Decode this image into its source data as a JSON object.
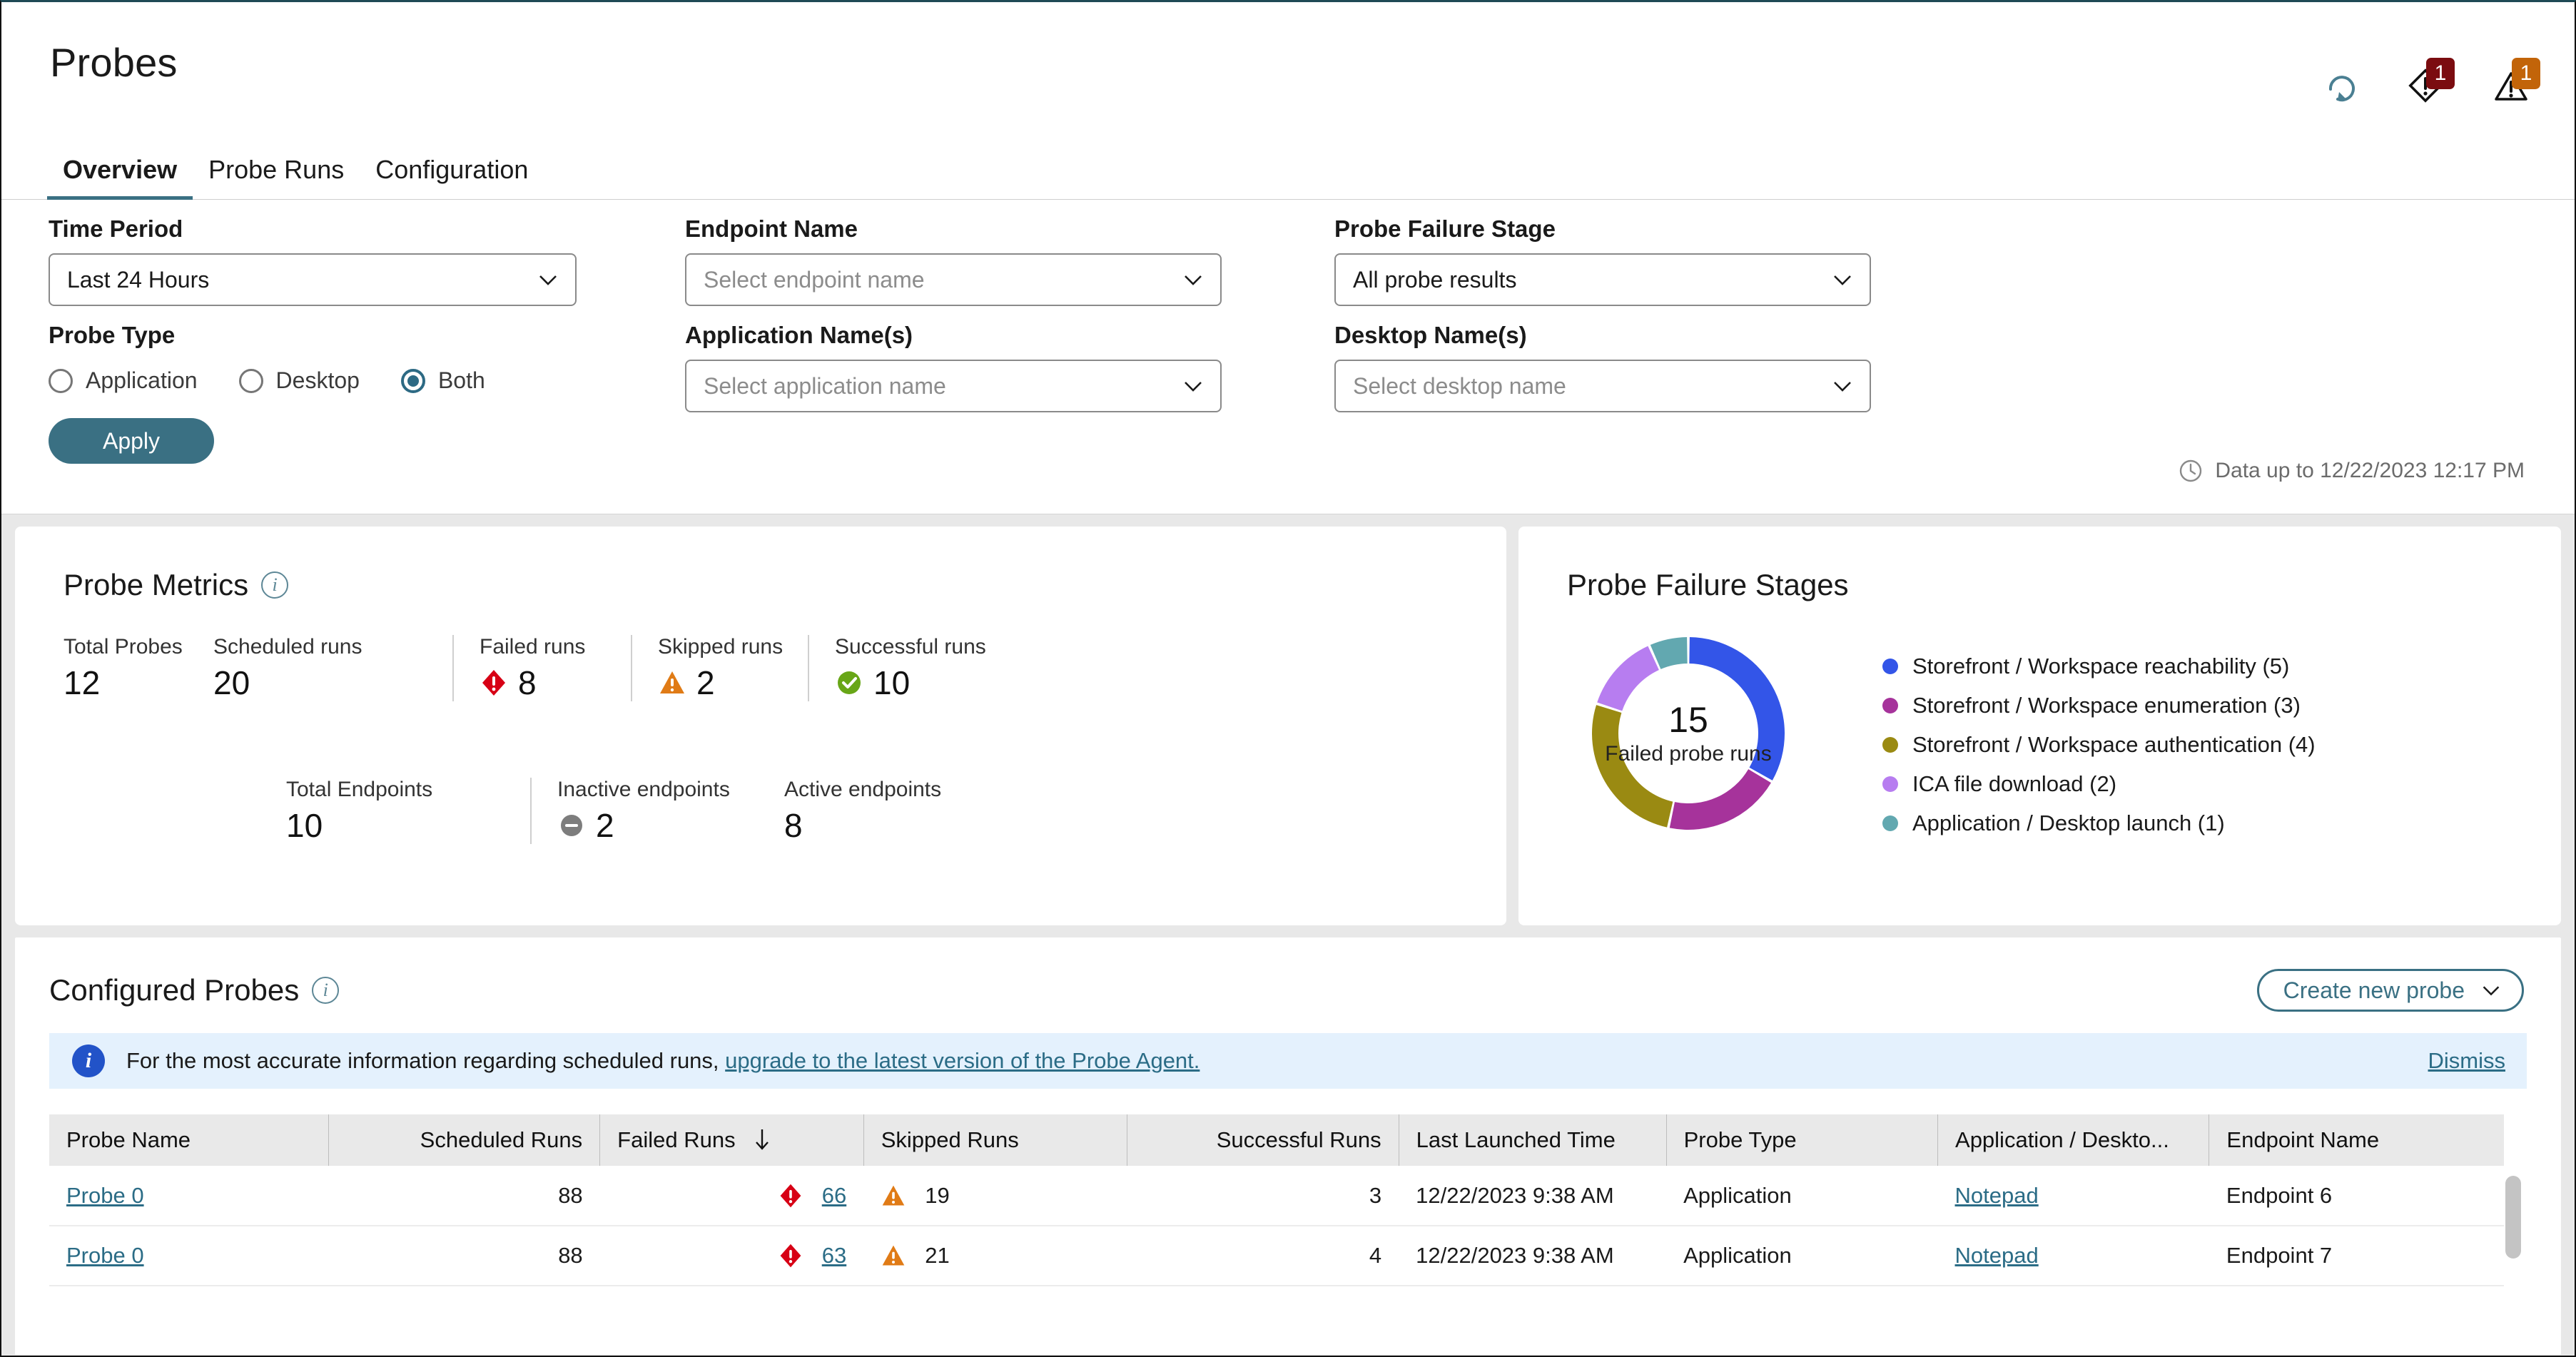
{
  "header": {
    "title": "Probes",
    "actions": [
      {
        "name": "refresh-icon",
        "badge": null
      },
      {
        "name": "critical-alert-icon",
        "badge": "1"
      },
      {
        "name": "warning-alert-icon",
        "badge": "1"
      }
    ],
    "tabs": [
      {
        "label": "Overview",
        "active": true
      },
      {
        "label": "Probe Runs",
        "active": false
      },
      {
        "label": "Configuration",
        "active": false
      }
    ]
  },
  "filters": {
    "time_period": {
      "label": "Time Period",
      "value": "Last 24 Hours"
    },
    "endpoint_name": {
      "label": "Endpoint Name",
      "placeholder": "Select endpoint name",
      "value": ""
    },
    "probe_failure_stage": {
      "label": "Probe Failure Stage",
      "value": "All probe results"
    },
    "probe_type": {
      "label": "Probe Type",
      "options": [
        {
          "label": "Application",
          "selected": false
        },
        {
          "label": "Desktop",
          "selected": false
        },
        {
          "label": "Both",
          "selected": true
        }
      ]
    },
    "application_names": {
      "label": "Application Name(s)",
      "placeholder": "Select application name",
      "value": ""
    },
    "desktop_names": {
      "label": "Desktop Name(s)",
      "placeholder": "Select desktop name",
      "value": ""
    },
    "apply_label": "Apply",
    "data_up_to": "Data up to 12/22/2023 12:17 PM"
  },
  "probe_metrics": {
    "title": "Probe Metrics",
    "row1": [
      {
        "label": "Total Probes",
        "value": "12",
        "icon": null
      },
      {
        "label": "Scheduled runs",
        "value": "20",
        "icon": null
      },
      {
        "label": "Failed runs",
        "value": "8",
        "icon": "failed-diamond-icon"
      },
      {
        "label": "Skipped runs",
        "value": "2",
        "icon": "skipped-triangle-icon"
      },
      {
        "label": "Successful runs",
        "value": "10",
        "icon": "success-check-icon"
      }
    ],
    "row2": [
      {
        "label": "Total Endpoints",
        "value": "10",
        "icon": null
      },
      {
        "label": "Inactive endpoints",
        "value": "2",
        "icon": "inactive-minus-icon"
      },
      {
        "label": "Active endpoints",
        "value": "8",
        "icon": null
      }
    ]
  },
  "chart_data": {
    "type": "pie",
    "title": "Probe Failure Stages",
    "center_value": "15",
    "center_label": "Failed probe runs",
    "total": 15,
    "categories": [
      "Storefront / Workspace reachability",
      "Storefront / Workspace enumeration",
      "Storefront / Workspace authentication",
      "ICA file download",
      "Application / Desktop launch"
    ],
    "values": [
      5,
      3,
      4,
      2,
      1
    ],
    "legend": [
      {
        "label": "Storefront / Workspace reachability (5)",
        "color": "#3355e8",
        "value": 5
      },
      {
        "label": "Storefront / Workspace enumeration (3)",
        "color": "#a6339b",
        "value": 3
      },
      {
        "label": "Storefront / Workspace authentication (4)",
        "color": "#9a8a12",
        "value": 4
      },
      {
        "label": "ICA file download (2)",
        "color": "#b77df0",
        "value": 2
      },
      {
        "label": "Application / Desktop launch (1)",
        "color": "#62a8b0",
        "value": 1
      }
    ],
    "legend_position": "right",
    "grid": false
  },
  "configured_probes": {
    "title": "Configured Probes",
    "create_button": "Create new probe",
    "banner": {
      "text_before": "For the most accurate information regarding scheduled runs,",
      "link": "upgrade to the latest version of the Probe Agent.",
      "dismiss": "Dismiss"
    },
    "table": {
      "columns": [
        "Probe Name",
        "Scheduled Runs",
        "Failed Runs",
        "Skipped Runs",
        "Successful Runs",
        "Last Launched Time",
        "Probe Type",
        "Application / Deskto...",
        "Endpoint Name"
      ],
      "sorted_column": "Failed Runs",
      "sort_direction": "desc",
      "rows": [
        {
          "probe_name": "Probe 0",
          "scheduled_runs": "88",
          "failed_runs": "66",
          "skipped_runs": "19",
          "successful_runs": "3",
          "last_launched_time": "12/22/2023 9:38 AM",
          "probe_type": "Application",
          "application_desktop": "Notepad",
          "endpoint_name": "Endpoint 6"
        },
        {
          "probe_name": "Probe 0",
          "scheduled_runs": "88",
          "failed_runs": "63",
          "skipped_runs": "21",
          "successful_runs": "4",
          "last_launched_time": "12/22/2023 9:38 AM",
          "probe_type": "Application",
          "application_desktop": "Notepad",
          "endpoint_name": "Endpoint 7"
        }
      ]
    }
  },
  "colors": {
    "accent": "#3a7083",
    "link": "#2b6c86",
    "failed": "#d70015",
    "skipped": "#e07b16",
    "success": "#68a617",
    "inactive": "#7d7d7d",
    "banner_bg": "#e4f1fd"
  }
}
